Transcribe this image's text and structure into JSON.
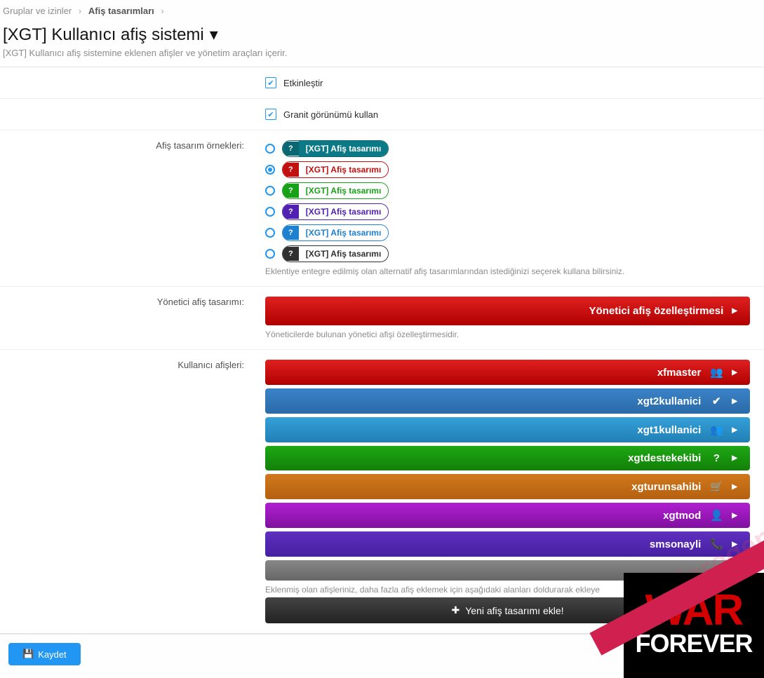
{
  "breadcrumb": {
    "item1": "Gruplar ve izinler",
    "item2": "Afiş tasarımları"
  },
  "page": {
    "title": "[XGT] Kullanıcı afiş sistemi",
    "desc": "[XGT] Kullanıcı afiş sistemine eklenen afişler ve yönetim araçları içerir."
  },
  "cb": {
    "enable": "Etkinleştir",
    "granite": "Granit görünümü kullan"
  },
  "labels": {
    "samples": "Afiş tasarım örnekleri:",
    "admin": "Yönetici afiş tasarımı:",
    "users": "Kullanıcı afişleri:"
  },
  "samples": {
    "items": [
      {
        "text": "[XGT] Afiş tasarımı",
        "icnbg": "#0a6670",
        "border": "#0a6670",
        "txtcolor": "#ffffff",
        "txtbg": "#0b7a86"
      },
      {
        "text": "[XGT] Afiş tasarımı",
        "icnbg": "#c01010",
        "border": "#c01010",
        "txtcolor": "#c01010",
        "txtbg": "#ffffff"
      },
      {
        "text": "[XGT] Afiş tasarımı",
        "icnbg": "#18a018",
        "border": "#18a018",
        "txtcolor": "#18a018",
        "txtbg": "#ffffff"
      },
      {
        "text": "[XGT] Afiş tasarımı",
        "icnbg": "#5020b0",
        "border": "#5020b0",
        "txtcolor": "#5020b0",
        "txtbg": "#ffffff"
      },
      {
        "text": "[XGT] Afiş tasarımı",
        "icnbg": "#2080d0",
        "border": "#2080d0",
        "txtcolor": "#2080d0",
        "txtbg": "#ffffff"
      },
      {
        "text": "[XGT] Afiş tasarımı",
        "icnbg": "#303030",
        "border": "#303030",
        "txtcolor": "#303030",
        "txtbg": "#ffffff"
      }
    ],
    "selected": 1,
    "help": "Eklentiye entegre edilmiş olan alternatif afiş tasarımlarından istediğinizi seçerek kullana bilirsiniz."
  },
  "admin": {
    "label": "Yönetici afiş özelleştirmesi",
    "help": "Yöneticilerde bulunan yönetici afişi özelleştirmesidir."
  },
  "users": {
    "items": [
      {
        "name": "xfmaster",
        "cls": "gradred",
        "icon": "users"
      },
      {
        "name": "xgt2kullanici",
        "cls": "gradblue1",
        "icon": "user-check"
      },
      {
        "name": "xgt1kullanici",
        "cls": "gradblue2",
        "icon": "users"
      },
      {
        "name": "xgtdestekekibi",
        "cls": "gradgreen",
        "icon": "question"
      },
      {
        "name": "xgturunsahibi",
        "cls": "gradorange",
        "icon": "cart"
      },
      {
        "name": "xgtmod",
        "cls": "gradpurple",
        "icon": "user"
      },
      {
        "name": "smsonayli",
        "cls": "gradindigo",
        "icon": "phone"
      },
      {
        "name": "",
        "cls": "gradgray",
        "icon": ""
      }
    ],
    "help": "Eklenmiş olan afişleriniz, daha fazla afiş eklemek için aşağıdaki alanları doldurarak ekleye",
    "add": "Yeni afiş tasarımı ekle!"
  },
  "footer": {
    "save": "Kaydet"
  },
  "watermark": "xenforogen.tr",
  "corner": {
    "line1": "WAR",
    "line2": "FOREVER"
  }
}
